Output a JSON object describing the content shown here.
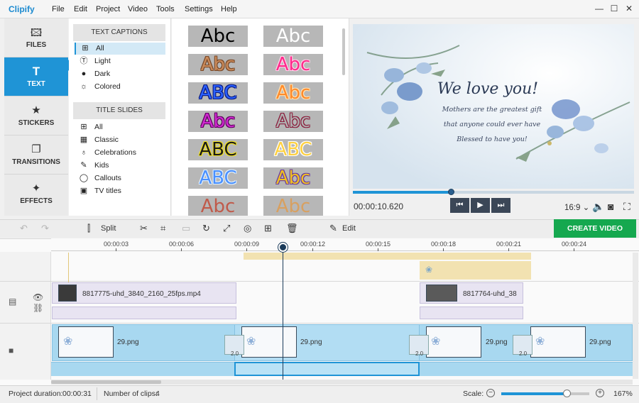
{
  "app": {
    "name": "Clipify"
  },
  "menu": [
    "File",
    "Edit",
    "Project",
    "Video",
    "Tools",
    "Settings",
    "Help"
  ],
  "window_controls": {
    "minimize": "—",
    "maximize": "☐",
    "close": "✕"
  },
  "sidebar": {
    "items": [
      {
        "label": "FILES",
        "icon": "image-icon",
        "glyph": "🖾"
      },
      {
        "label": "TEXT",
        "icon": "text-icon",
        "glyph": "T",
        "active": true
      },
      {
        "label": "STICKERS",
        "icon": "star-icon",
        "glyph": "★"
      },
      {
        "label": "TRANSITIONS",
        "icon": "transition-icon",
        "glyph": "❐"
      },
      {
        "label": "EFFECTS",
        "icon": "magic-wand-icon",
        "glyph": "✦"
      }
    ]
  },
  "categories": {
    "text_captions": {
      "header": "TEXT CAPTIONS",
      "items": [
        {
          "label": "All",
          "glyph": "⊞",
          "selected": true
        },
        {
          "label": "Light",
          "glyph": "Ⓣ"
        },
        {
          "label": "Dark",
          "glyph": "●"
        },
        {
          "label": "Colored",
          "glyph": "☼"
        }
      ]
    },
    "title_slides": {
      "header": "TITLE SLIDES",
      "items": [
        {
          "label": "All",
          "glyph": "⊞"
        },
        {
          "label": "Classic",
          "glyph": "▦"
        },
        {
          "label": "Celebrations",
          "glyph": "♁"
        },
        {
          "label": "Kids",
          "glyph": "✎"
        },
        {
          "label": "Callouts",
          "glyph": "◯"
        },
        {
          "label": "TV titles",
          "glyph": "▣"
        }
      ]
    }
  },
  "gallery": {
    "tiles": [
      {
        "text": "Abc",
        "color": "#000000",
        "stroke": "none"
      },
      {
        "text": "Abc",
        "color": "#ffffff",
        "stroke": "none"
      },
      {
        "text": "Abc",
        "color": "#c98a5a",
        "stroke": "#7a4a2a"
      },
      {
        "text": "Abc",
        "color": "#ff2a8a",
        "stroke": "#ffd0e8"
      },
      {
        "text": "ABC",
        "color": "#2a60ff",
        "stroke": "#0a1a80"
      },
      {
        "text": "Abc",
        "color": "#ff8a2a",
        "stroke": "#ffe0b0"
      },
      {
        "text": "Abc",
        "color": "#d02ad0",
        "stroke": "#600060"
      },
      {
        "text": "Abc",
        "color": "#b0b0b0",
        "stroke": "#8a1a3a"
      },
      {
        "text": "ABC",
        "color": "#1a1a1a",
        "stroke": "#f0e020"
      },
      {
        "text": "ABC",
        "color": "#ffd040",
        "stroke": "#ffffff"
      },
      {
        "text": "ABC",
        "color": "#4a90ff",
        "stroke": "#e0f0ff"
      },
      {
        "text": "Abc",
        "color": "#f0c020",
        "stroke": "#6a3aa0"
      },
      {
        "text": "Abc",
        "color": "#c05a4a",
        "stroke": "none"
      },
      {
        "text": "Abc",
        "color": "#d8a060",
        "stroke": "none"
      }
    ]
  },
  "preview": {
    "title": "We love you!",
    "lines": [
      "Mothers are the greatest gift",
      "that anyone could ever have",
      "Blessed to have you!"
    ],
    "timecode": "00:00:10.620",
    "progress_fraction": 0.35,
    "aspect": "16:9 ⌄",
    "controls": {
      "prev": "⏮",
      "play": "▶",
      "next": "⏭"
    }
  },
  "toolbar": {
    "split_label": "Split",
    "edit_label": "Edit",
    "create_label": "CREATE VIDEO"
  },
  "timeline": {
    "ticks": [
      "00:00:03",
      "00:00:06",
      "00:00:09",
      "00:00:12",
      "00:00:15",
      "00:00:18",
      "00:00:21",
      "00:00:24"
    ],
    "text_clips": [
      "8817775-uhd_3840_2160_25fps.mp4",
      "8817764-uhd_38"
    ],
    "video_clips": [
      "29.png",
      "29.png",
      "29.png",
      "29.png"
    ],
    "transitions": [
      "2.0",
      "2.0",
      "2.0"
    ]
  },
  "status": {
    "duration_label": "Project duration:",
    "duration_value": "00:00:31",
    "clips_label": "Number of clips:",
    "clips_value": "4",
    "scale_label": "Scale:",
    "scale_value": "167%",
    "scale_fraction": 0.74
  },
  "colors": {
    "accent": "#1f94d6",
    "create": "#15a84f",
    "video_track": "#a8d8f0"
  }
}
